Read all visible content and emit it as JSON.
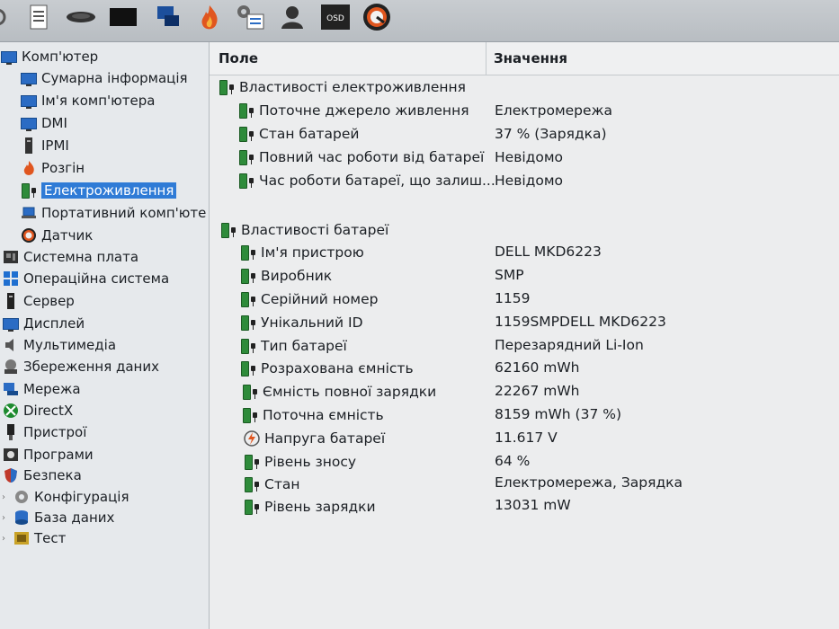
{
  "toolbar": {
    "icons": [
      "refresh-icon",
      "report-icon",
      "disk-icon",
      "monitor-icon",
      "network-icon",
      "flame-icon",
      "settings-icon",
      "user-icon",
      "osd-icon",
      "sensor-icon"
    ],
    "osd_label": "OSD"
  },
  "tree": {
    "root": "Комп'ютер",
    "children": [
      "Сумарна інформація",
      "Ім'я комп'ютера",
      "DMI",
      "IPMI",
      "Розгін",
      "Електроживлення",
      "Портативний комп'юте",
      "Датчик"
    ],
    "top_level": [
      "Системна плата",
      "Операційна система",
      "Сервер",
      "Дисплей",
      "Мультимедіа",
      "Збереження даних",
      "Мережа",
      "DirectX",
      "Пристрої",
      "Програми",
      "Безпека",
      "Конфігурація",
      "База даних",
      "Тест"
    ]
  },
  "table": {
    "col_field": "Поле",
    "col_value": "Значення",
    "group1": "Властивості електроживлення",
    "rows1": [
      {
        "field": "Поточне джерело живлення",
        "value": "Електромережа"
      },
      {
        "field": "Стан батарей",
        "value": "37 % (Зарядка)"
      },
      {
        "field": "Повний час роботи від батареї",
        "value": "Невідомо"
      },
      {
        "field": "Час роботи батареї, що залиш...",
        "value": "Невідомо"
      }
    ],
    "group2": "Властивості батареї",
    "rows2": [
      {
        "field": "Ім'я пристрою",
        "value": "DELL MKD6223"
      },
      {
        "field": "Виробник",
        "value": "SMP"
      },
      {
        "field": "Серійний номер",
        "value": "1159"
      },
      {
        "field": "Унікальний ID",
        "value": "1159SMPDELL MKD6223"
      },
      {
        "field": "Тип батареї",
        "value": "Перезарядний Li-Ion"
      },
      {
        "field": "Розрахована ємність",
        "value": "62160 mWh"
      },
      {
        "field": "Ємність повної зарядки",
        "value": "22267 mWh"
      },
      {
        "field": "Поточна ємність",
        "value": "8159 mWh  (37 %)"
      },
      {
        "field": "Напруга батареї",
        "value": "11.617 V"
      },
      {
        "field": "Рівень зносу",
        "value": "64 %"
      },
      {
        "field": "Стан",
        "value": "Електромережа, Зарядка"
      },
      {
        "field": "Рівень зарядки",
        "value": "13031 mW"
      }
    ]
  }
}
